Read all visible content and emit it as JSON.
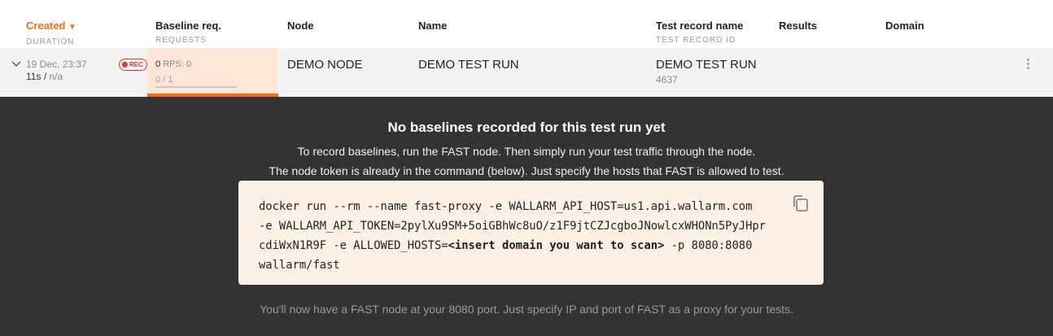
{
  "header": {
    "created": "Created",
    "created_arrow": "▼",
    "duration": "DURATION",
    "baseline": "Baseline req.",
    "requests": "REQUESTS",
    "node": "Node",
    "name": "Name",
    "test_record_name": "Test record name",
    "test_record_id": "TEST RECORD ID",
    "results": "Results",
    "domain": "Domain"
  },
  "row": {
    "date": "19 Dec, 23:37",
    "duration": "11s",
    "duration_sep": "/",
    "duration_na": "n/a",
    "rec_badge": "REC",
    "baseline_count": "0",
    "rps": "RPS: 0",
    "progress_text": "0 / 1",
    "progress_fraction": 0,
    "node": "DEMO NODE",
    "name": "DEMO TEST RUN",
    "test_record_name": "DEMO TEST RUN",
    "test_record_id": "4637"
  },
  "panel": {
    "title": "No baselines recorded for this test run yet",
    "line1": "To record baselines, run the FAST node. Then simply run your test traffic through the node.",
    "line2": "The node token is already in the command (below). Just specify the hosts that FAST is allowed to test.",
    "code_line1": "docker run --rm --name fast-proxy -e WALLARM_API_HOST=us1.api.wallarm.com",
    "code_line2": "-e WALLARM_API_TOKEN=2pylXu9SM+5oiGBhWc8uO/z1F9jtCZJcgboJNowlcxWHONn5PyJHpr",
    "code_line3_a": "cdiWxN1R9F -e ALLOWED_HOSTS=",
    "code_line3_b": "<insert domain you want to scan>",
    "code_line3_c": " -p 8080:8080",
    "code_line4": "wallarm/fast",
    "footer": "You'll now have a FAST node at your 8080 port. Just specify IP and port of FAST as a proxy for your tests."
  },
  "colors": {
    "accent": "#f26a1b",
    "panel_bg": "#333333",
    "code_bg": "#fdf1e6",
    "rec": "#d9363e",
    "baseline_bg": "#fde6d8"
  },
  "icons": [
    "chevron-down-icon",
    "rec-dot-icon",
    "kebab-menu-icon",
    "copy-icon"
  ]
}
